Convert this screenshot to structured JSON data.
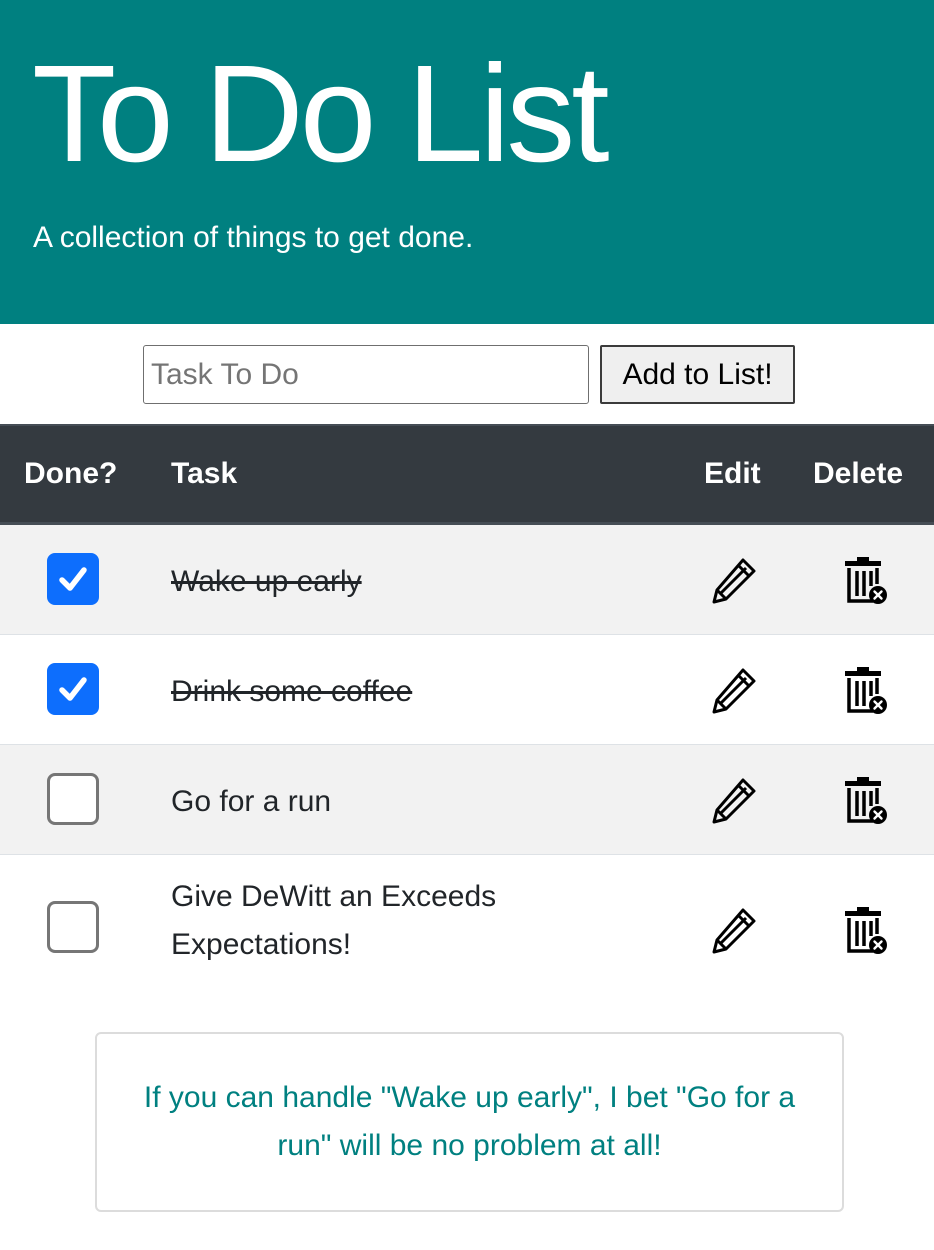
{
  "header": {
    "title": "To Do List",
    "subtitle": "A collection of things to get done."
  },
  "form": {
    "placeholder": "Task To Do",
    "value": "",
    "add_label": "Add to List!"
  },
  "table": {
    "headers": {
      "done": "Done?",
      "task": "Task",
      "edit": "Edit",
      "delete": "Delete"
    },
    "rows": [
      {
        "done": true,
        "task": "Wake up early",
        "edit_icon": "pencil-icon",
        "delete_icon": "trash-icon"
      },
      {
        "done": true,
        "task": "Drink some coffee",
        "edit_icon": "pencil-icon",
        "delete_icon": "trash-icon"
      },
      {
        "done": false,
        "task": "Go for a run",
        "edit_icon": "pencil-icon",
        "delete_icon": "trash-icon"
      },
      {
        "done": false,
        "task": "Give DeWitt an Exceeds Expectations!",
        "edit_icon": "pencil-icon",
        "delete_icon": "trash-icon"
      }
    ]
  },
  "tip": {
    "text": "If you can handle \"Wake up early\", I bet \"Go for a run\" will be no problem at all!"
  },
  "colors": {
    "brand": "#008080",
    "header_bg": "#343a40",
    "checkbox_checked": "#0d6efd",
    "stripe": "#f2f2f2"
  }
}
